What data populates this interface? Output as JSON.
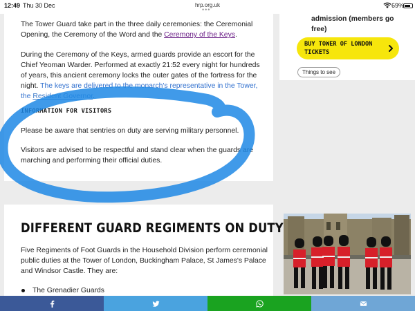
{
  "status_bar": {
    "time": "12:49",
    "date": "Thu 30 Dec",
    "url": "hrp.org.uk",
    "more": "•••",
    "battery": "69%"
  },
  "article": {
    "para1": {
      "text": "The Tower Guard take part in the three daily ceremonies: the Ceremonial Opening, the Ceremony of the Word and the ",
      "link": "Ceremony of the Keys",
      "end": "."
    },
    "para2": {
      "text": "During the Ceremony of the Keys, armed guards provide an escort for the Chief Yeoman Warder. Performed at exactly 21:52 every night for hundreds of years, this ancient ceremony locks the outer gates of the fortress for the night.",
      "highlight": " The keys are delivered to the monarch's representative in the Tower, the ",
      "link": "Resident Governor",
      "end": "."
    },
    "visitors_heading": "INFORMATION FOR VISITORS",
    "visitors_p1": "Please be aware that sentries on duty are serving military personnel.",
    "visitors_p2": "Visitors are advised to be respectful and stand clear when the guards are marching and performing their official duties.",
    "section_heading": "DIFFERENT GUARD REGIMENTS ON DUTY",
    "section_p": "Five Regiments of Foot Guards in the Household Division perform ceremonial public duties at the Tower of London, Buckingham Palace, St James's Palace and Windsor Castle. They are:",
    "list_items": [
      "The Grenadier Guards"
    ]
  },
  "sidebar": {
    "admission_line1": "admission (members go",
    "admission_line2": "free)",
    "cta_line1": "BUY TOWER OF LONDON",
    "cta_line2": "TICKETS",
    "chip": "Things to see"
  },
  "share": {
    "icons": [
      "facebook-icon",
      "twitter-icon",
      "whatsapp-icon",
      "email-icon"
    ]
  },
  "colors": {
    "accent_yellow": "#f6e60c",
    "scribble_blue": "#1e88e5",
    "facebook": "#3b5998",
    "twitter": "#4aa3df",
    "whatsapp": "#1aa320",
    "email": "#6fa6d6"
  }
}
